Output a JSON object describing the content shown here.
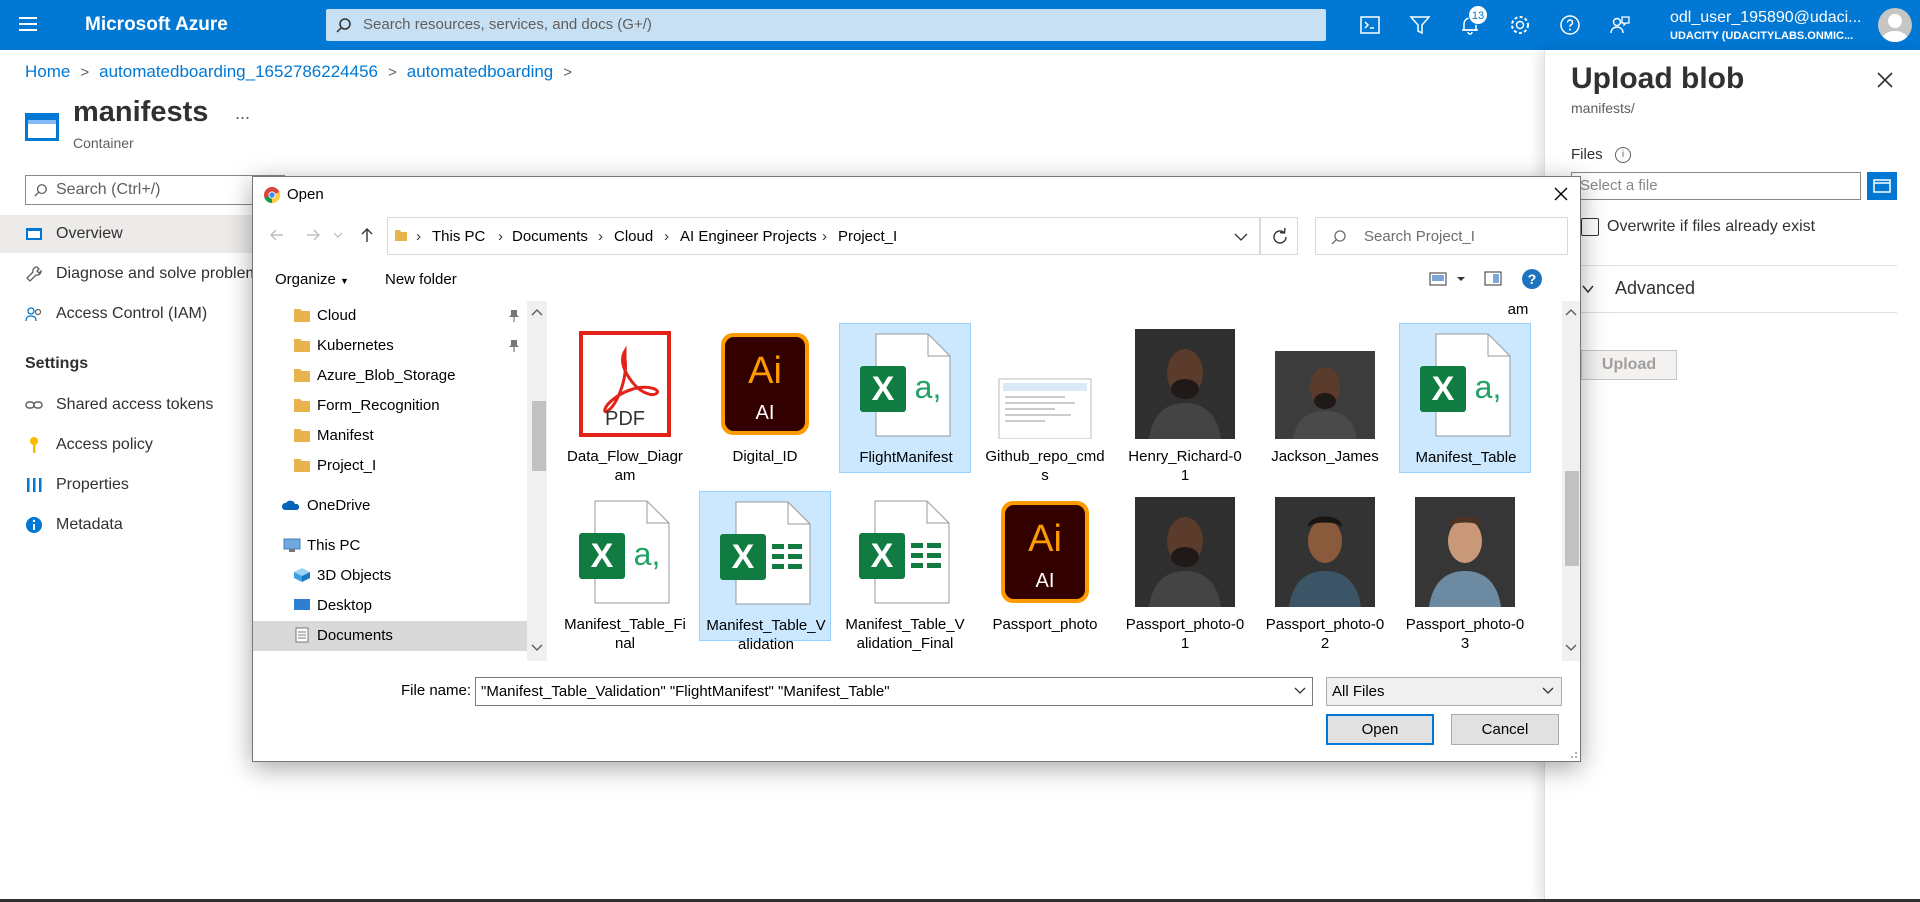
{
  "topbar": {
    "brand": "Microsoft Azure",
    "search_placeholder": "Search resources, services, and docs (G+/)",
    "notification_count": "13",
    "user_name": "odl_user_195890@udaci...",
    "user_tenant": "UDACITY (UDACITYLABS.ONMIC...",
    "icons": [
      "cloud-shell-icon",
      "directory-filter-icon",
      "bell-icon",
      "gear-icon",
      "help-icon",
      "feedback-icon"
    ]
  },
  "breadcrumb": [
    "Home",
    "automatedboarding_1652786224456",
    "automatedboarding"
  ],
  "page": {
    "title": "manifests",
    "subtitle": "Container",
    "more": "..."
  },
  "nav": {
    "search_placeholder": "Search (Ctrl+/)",
    "items": [
      {
        "label": "Overview",
        "icon": "overview-icon"
      },
      {
        "label": "Diagnose and solve problems",
        "icon": "wrench-icon"
      },
      {
        "label": "Access Control (IAM)",
        "icon": "people-icon"
      }
    ],
    "section": "Settings",
    "settings_items": [
      {
        "label": "Shared access tokens",
        "icon": "link-icon"
      },
      {
        "label": "Access policy",
        "icon": "key-icon"
      },
      {
        "label": "Properties",
        "icon": "properties-icon"
      },
      {
        "label": "Metadata",
        "icon": "info-icon"
      }
    ]
  },
  "panel": {
    "title": "Upload blob",
    "subtitle": "manifests/",
    "files_label": "Files",
    "files_placeholder": "Select a file",
    "overwrite_label": "Overwrite if files already exist",
    "advanced_label": "Advanced",
    "upload_label": "Upload"
  },
  "dialog": {
    "title": "Open",
    "path": [
      "This PC",
      "Documents",
      "Cloud",
      "AI Engineer Projects",
      "Project_I"
    ],
    "search_placeholder": "Search Project_I",
    "organize": "Organize",
    "new_folder": "New folder",
    "tree": [
      {
        "label": "Cloud",
        "icon": "folder-icon",
        "pinned": true
      },
      {
        "label": "Kubernetes",
        "icon": "folder-icon",
        "pinned": true
      },
      {
        "label": "Azure_Blob_Storage",
        "icon": "folder-icon"
      },
      {
        "label": "Form_Recognition",
        "icon": "folder-icon"
      },
      {
        "label": "Manifest",
        "icon": "folder-icon"
      },
      {
        "label": "Project_I",
        "icon": "folder-icon"
      },
      {
        "label": "OneDrive",
        "icon": "onedrive-icon"
      },
      {
        "label": "This PC",
        "icon": "pc-icon"
      },
      {
        "label": "3D Objects",
        "icon": "3d-objects-icon"
      },
      {
        "label": "Desktop",
        "icon": "desktop-icon"
      },
      {
        "label": "Documents",
        "icon": "documents-icon",
        "selected": true
      }
    ],
    "partial_top_label": "am",
    "files_row1": [
      {
        "name": "Data_Flow_Diagram",
        "display": "Data_Flow_Diagr\nam",
        "kind": "pdf"
      },
      {
        "name": "Digital_ID",
        "display": "Digital_ID",
        "kind": "ai"
      },
      {
        "name": "FlightManifest",
        "display": "FlightManifest",
        "kind": "excel-csv",
        "selected": true
      },
      {
        "name": "Github_repo_cmds",
        "display": "Github_repo_cmd\ns",
        "kind": "doc"
      },
      {
        "name": "Henry_Richard-01",
        "display": "Henry_Richard-0\n1",
        "kind": "photo"
      },
      {
        "name": "Jackson_James",
        "display": "Jackson_James",
        "kind": "photo"
      },
      {
        "name": "Manifest_Table",
        "display": "Manifest_Table",
        "kind": "excel-csv",
        "selected": true
      }
    ],
    "files_row2": [
      {
        "name": "Manifest_Table_Final",
        "display": "Manifest_Table_Fi\nnal",
        "kind": "excel-csv"
      },
      {
        "name": "Manifest_Table_Validation",
        "display": "Manifest_Table_V\nalidation",
        "kind": "excel",
        "selected": true
      },
      {
        "name": "Manifest_Table_Validation_Final",
        "display": "Manifest_Table_V\nalidation_Final",
        "kind": "excel"
      },
      {
        "name": "Passport_photo",
        "display": "Passport_photo",
        "kind": "ai"
      },
      {
        "name": "Passport_photo-01",
        "display": "Passport_photo-0\n1",
        "kind": "photo"
      },
      {
        "name": "Passport_photo-02",
        "display": "Passport_photo-0\n2",
        "kind": "photo"
      },
      {
        "name": "Passport_photo-03",
        "display": "Passport_photo-0\n3",
        "kind": "photo"
      }
    ],
    "filename_label": "File name:",
    "filename_value": "\"Manifest_Table_Validation\" \"FlightManifest\" \"Manifest_Table\"",
    "filetype": "All Files",
    "open_label": "Open",
    "cancel_label": "Cancel"
  }
}
